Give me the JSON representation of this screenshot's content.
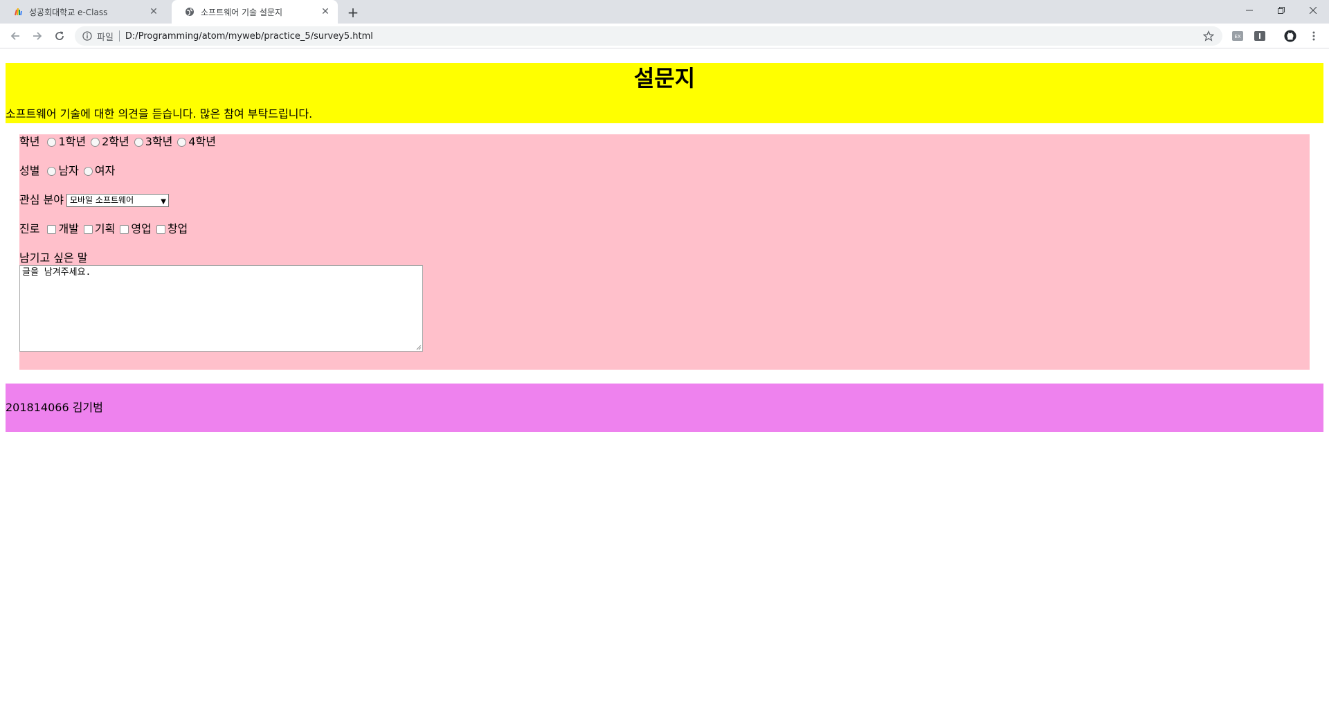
{
  "browser": {
    "tabs": [
      {
        "title": "성공회대학교 e-Class",
        "icon": "eclass-logo-icon",
        "active": false
      },
      {
        "title": "소프트웨어 기술 설문지",
        "icon": "globe-icon",
        "active": true
      }
    ],
    "address": {
      "scheme_label": "파일",
      "url": "D:/Programming/atom/myweb/practice_5/survey5.html"
    }
  },
  "page": {
    "title": "설문지",
    "subtitle": "소프트웨어 기술에 대한 의견을 듣습니다. 많은 참여 부탁드립니다.",
    "grade": {
      "label": "학년",
      "options": [
        "1학년",
        "2학년",
        "3학년",
        "4학년"
      ]
    },
    "gender": {
      "label": "성별",
      "options": [
        "남자",
        "여자"
      ]
    },
    "interest": {
      "label": "관심 분야",
      "selected": "모바일 소프트웨어"
    },
    "career": {
      "label": "진로",
      "options": [
        "개발",
        "기획",
        "영업",
        "창업"
      ]
    },
    "message": {
      "label": "남기고 싶은 말",
      "value": "글을 남겨주세요."
    },
    "footer": "201814066 김기범"
  },
  "colors": {
    "header_bg": "#ffff00",
    "form_bg": "#ffc0cb",
    "footer_bg": "#ee82ee"
  }
}
